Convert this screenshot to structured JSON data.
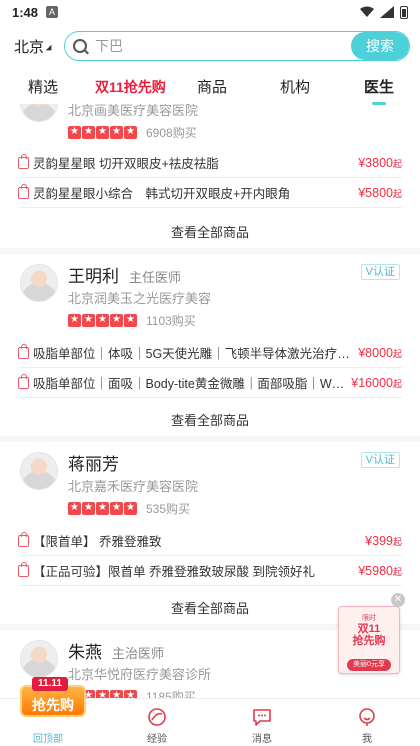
{
  "status_bar": {
    "time": "1:48",
    "badge": "A"
  },
  "search": {
    "city": "北京",
    "placeholder": "下巴",
    "button_label": "搜索"
  },
  "tabs": [
    {
      "label": "精选"
    },
    {
      "label": "双11抢先购"
    },
    {
      "label": "商品"
    },
    {
      "label": "机构"
    },
    {
      "label": "医生",
      "active": true
    }
  ],
  "cards": [
    {
      "hospital": "北京画美医疗美容医院",
      "stars": 5,
      "sales": "6908购买",
      "items": [
        {
          "name": "灵韵星星眼 切开双眼皮+祛皮祛脂",
          "price": "¥3800",
          "unit": "起"
        },
        {
          "name": "灵韵星星眼小综合　韩式切开双眼皮+开内眼角",
          "price": "¥5800",
          "unit": "起"
        }
      ],
      "view_all": "查看全部商品"
    },
    {
      "name": "王明利",
      "title": "主任医师",
      "verified": "V认证",
      "hospital": "北京润美玉之光医疗美容",
      "stars": 5,
      "sales": "1103购买",
      "items": [
        {
          "name": "吸脂单部位｜体吸｜5G天使光雕｜飞顿半导体激光治疗仪｜W...",
          "price": "¥8000",
          "unit": "起"
        },
        {
          "name": "吸脂单部位｜面吸｜Body-tite黄金微雕｜面部吸脂｜WML",
          "price": "¥16000",
          "unit": "起"
        }
      ],
      "view_all": "查看全部商品"
    },
    {
      "name": "蒋丽芳",
      "verified": "V认证",
      "hospital": "北京嘉禾医疗美容医院",
      "stars": 5,
      "sales": "535购买",
      "items": [
        {
          "name": "【限首单】 乔雅登雅致",
          "price": "¥399",
          "unit": "起"
        },
        {
          "name": "【正品可验】限首单 乔雅登雅致玻尿酸 到院领好礼",
          "price": "¥5980",
          "unit": "起"
        }
      ],
      "view_all": "查看全部商品"
    },
    {
      "name": "朱燕",
      "title": "主治医师",
      "hospital": "北京华悦府医疗美容诊所",
      "stars": 5,
      "sales": "1185购买"
    }
  ],
  "float_ad": {
    "line1": "限时",
    "line2": "双11\n抢先购",
    "line3": "美丽0元享"
  },
  "tabbar": {
    "promo_top": "11.11",
    "promo_text": "抢先购",
    "items": [
      {
        "label": "回顶部",
        "icon": "back-to-top-icon"
      },
      {
        "label": "经验",
        "icon": "experience-icon"
      },
      {
        "label": "消息",
        "icon": "message-icon"
      },
      {
        "label": "我",
        "icon": "profile-icon"
      }
    ]
  },
  "colors": {
    "accent": "#4dd0d8",
    "price": "#ef2d45",
    "sale_tab": "#e91e3a",
    "star": "#f2484b"
  }
}
